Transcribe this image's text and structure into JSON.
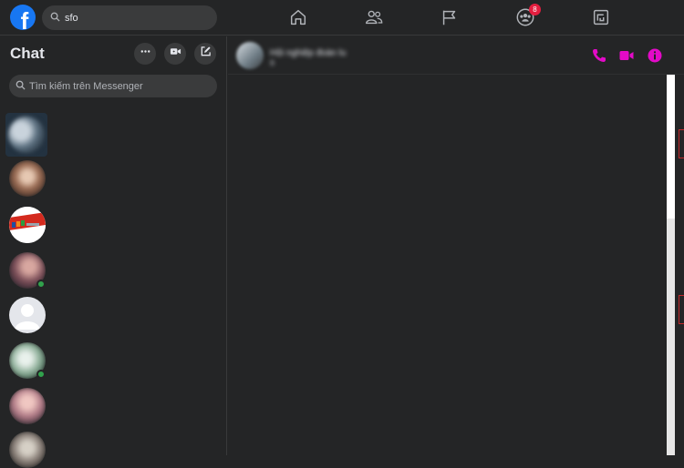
{
  "topbar": {
    "logo_letter": "f",
    "search_value": "sfo",
    "nav": [
      {
        "name": "home-icon"
      },
      {
        "name": "friends-icon"
      },
      {
        "name": "pages-flag-icon"
      },
      {
        "name": "groups-icon",
        "badge": "8"
      },
      {
        "name": "gaming-icon"
      }
    ]
  },
  "sidebar": {
    "title": "Chat",
    "search_placeholder": "Tìm kiếm trên Messenger",
    "actions": [
      "more-options-icon",
      "new-room-video-icon",
      "new-message-icon"
    ]
  },
  "conversation": {
    "name": "Hội nghiệp đoàn lu",
    "subtitle": "B",
    "header_actions": [
      "audio-call-icon",
      "video-call-icon",
      "info-icon"
    ]
  },
  "colors": {
    "background": "#242526",
    "accent": "#e30ac8",
    "facebook_blue": "#1877f2",
    "badge_red": "#e41e3f",
    "online_green": "#31a24c"
  }
}
